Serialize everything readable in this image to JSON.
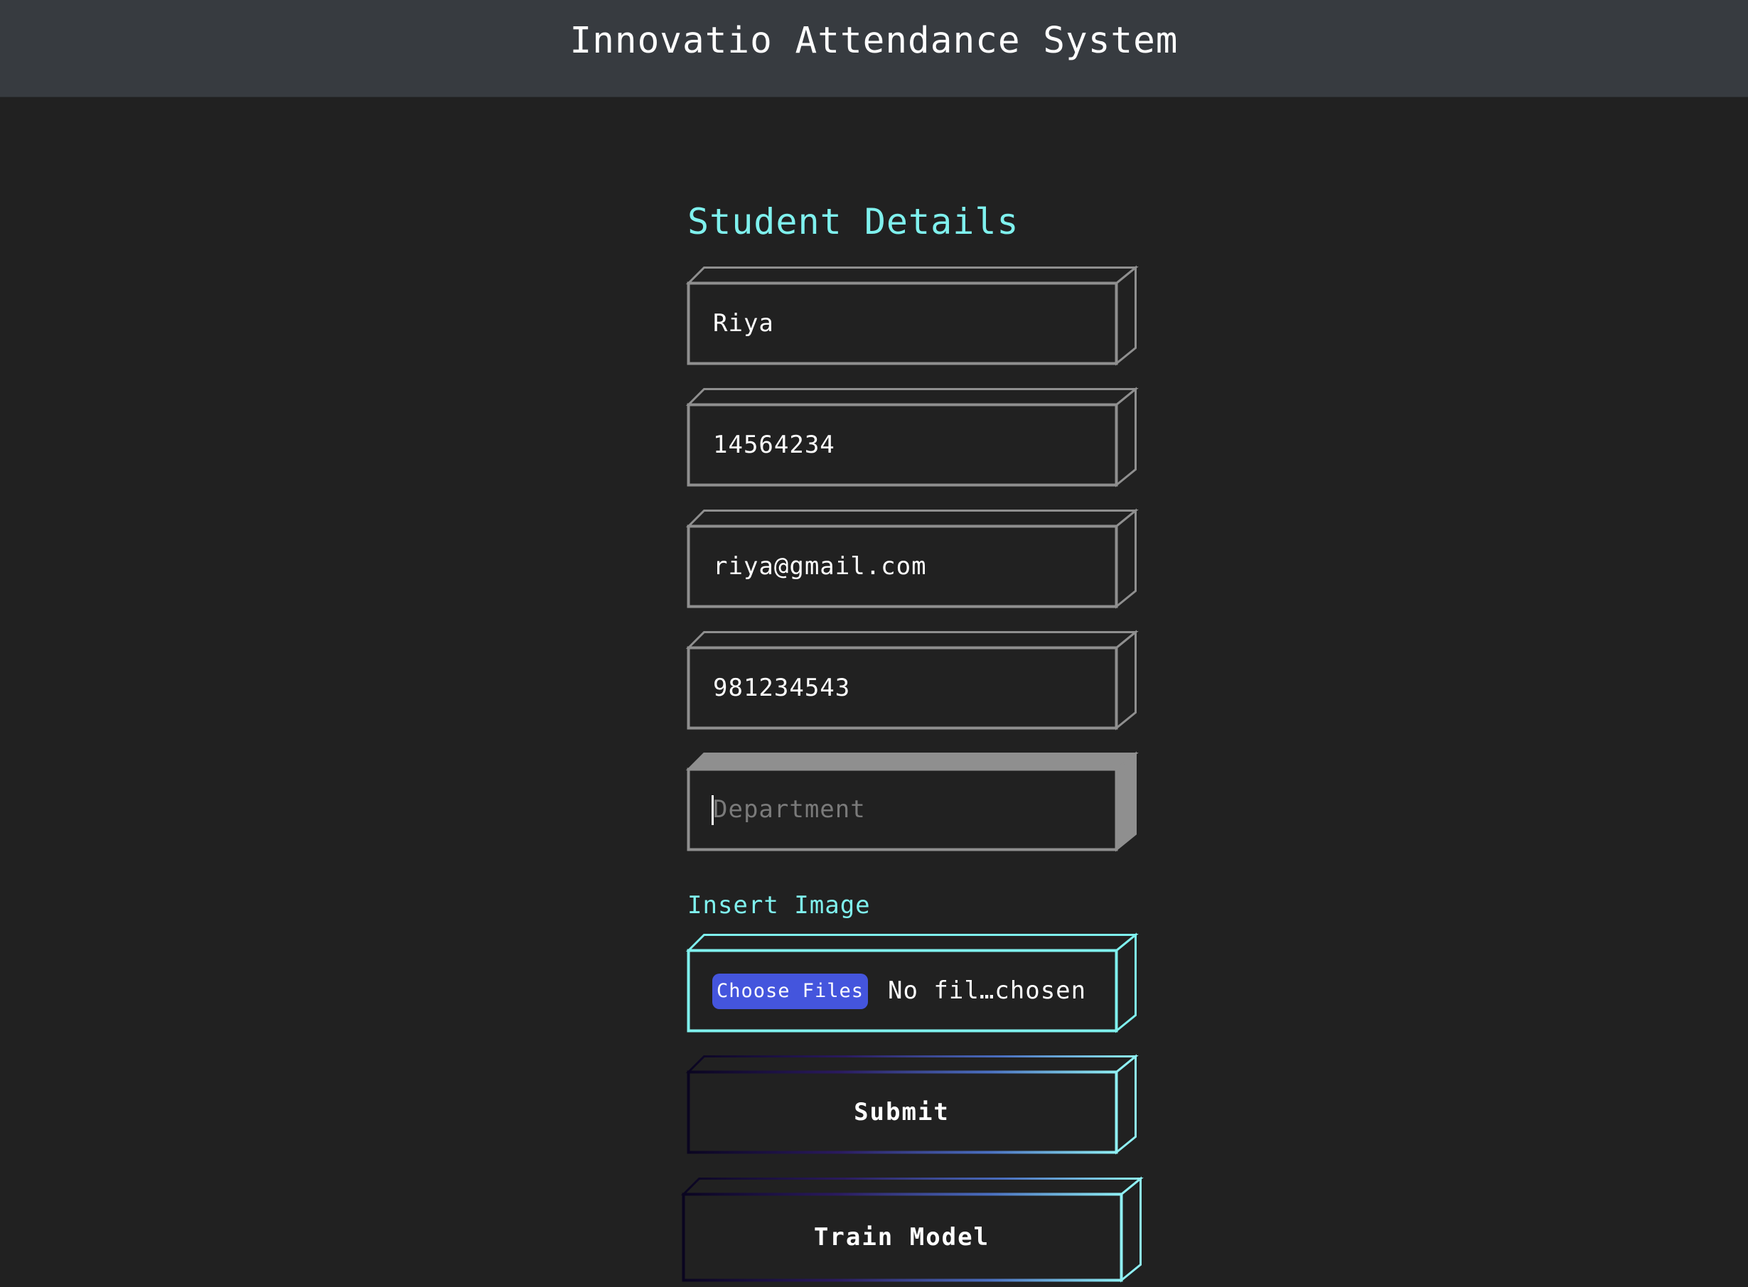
{
  "header": {
    "title": "Innovatio Attendance System"
  },
  "form": {
    "section_title": "Student Details",
    "fields": [
      {
        "value": "Riya"
      },
      {
        "value": "14564234"
      },
      {
        "value": "riya@gmail.com"
      },
      {
        "value": "981234543"
      },
      {
        "value": "",
        "placeholder": "Department"
      }
    ],
    "insert_image_label": "Insert Image",
    "file_input": {
      "button_label": "Choose Files",
      "status": "No fil…chosen"
    },
    "submit_label": "Submit",
    "train_label": "Train Model"
  },
  "colors": {
    "background": "#212121",
    "header": "#373b40",
    "accent": "#7ff1ee",
    "field_border": "#8f8f8f",
    "file_button": "#4455dd"
  }
}
